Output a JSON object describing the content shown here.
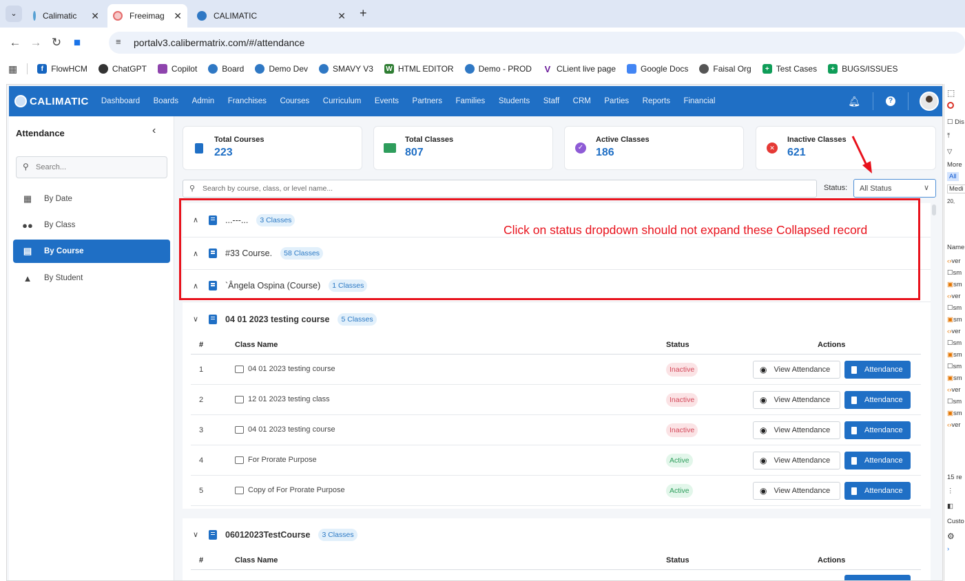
{
  "browser": {
    "tabs": [
      {
        "title": "Calimatic",
        "favicon_color": "#56a0d3"
      },
      {
        "title": "Freeimag",
        "favicon_color": "#e46a6a"
      },
      {
        "title": "CALIMATIC",
        "favicon_color": "#2f78c4"
      }
    ],
    "url": "portalv3.calibermatrix.com/#/attendance",
    "bookmarks": [
      {
        "label": "FlowHCM",
        "color": "#1565c0"
      },
      {
        "label": "ChatGPT",
        "color": "#333333"
      },
      {
        "label": "Copilot",
        "color": "#8e44ad"
      },
      {
        "label": "Board",
        "color": "#2f78c4"
      },
      {
        "label": "Demo Dev",
        "color": "#2f78c4"
      },
      {
        "label": "SMAVY V3",
        "color": "#2f78c4"
      },
      {
        "label": "HTML EDITOR",
        "color": "#2e7d32"
      },
      {
        "label": "Demo - PROD",
        "color": "#2f78c4"
      },
      {
        "label": "CLient live page",
        "color": "#6a1b9a"
      },
      {
        "label": "Google Docs",
        "color": "#4285f4"
      },
      {
        "label": "Faisal Org",
        "color": "#555555"
      },
      {
        "label": "Test Cases",
        "color": "#0f9d58"
      },
      {
        "label": "BUGS/ISSUES",
        "color": "#0f9d58"
      }
    ]
  },
  "app": {
    "logo_text": "CALIMATIC",
    "menu": [
      "Dashboard",
      "Boards",
      "Admin",
      "Franchises",
      "Courses",
      "Curriculum",
      "Events",
      "Partners",
      "Families",
      "Students",
      "Staff",
      "CRM",
      "Parties",
      "Reports",
      "Financial"
    ],
    "sidebar": {
      "title": "Attendance",
      "search_placeholder": "Search...",
      "items": [
        {
          "label": "By Date",
          "icon": "calendar-icon"
        },
        {
          "label": "By Class",
          "icon": "users-icon"
        },
        {
          "label": "By Course",
          "icon": "book-icon",
          "active": true
        },
        {
          "label": "By Student",
          "icon": "user-icon"
        }
      ]
    },
    "stats": [
      {
        "label": "Total Courses",
        "value": "223",
        "color": "#1f6fc5"
      },
      {
        "label": "Total Classes",
        "value": "807",
        "color": "#2e9d5c"
      },
      {
        "label": "Active Classes",
        "value": "186",
        "color": "#8e5bd6"
      },
      {
        "label": "Inactive Classes",
        "value": "621",
        "color": "#e53935"
      }
    ],
    "search_placeholder": "Search by course, class, or level name...",
    "status_label": "Status:",
    "status_value": "All Status",
    "courses": [
      {
        "name": "...---...",
        "badge": "3 Classes",
        "expanded": false
      },
      {
        "name": "#33 Course.",
        "badge": "58 Classes",
        "expanded": false
      },
      {
        "name": "`Ângela Ospina (Course)",
        "badge": "1 Classes",
        "expanded": false
      },
      {
        "name": "04 01 2023 testing course",
        "badge": "5 Classes",
        "expanded": true
      },
      {
        "name": "06012023TestCourse",
        "badge": "3 Classes",
        "expanded": true
      }
    ],
    "table_headers": {
      "num": "#",
      "class_name": "Class Name",
      "status": "Status",
      "actions": "Actions"
    },
    "rows": [
      {
        "num": "1",
        "name": "04 01 2023 testing course",
        "status": "Inactive"
      },
      {
        "num": "2",
        "name": "12 01 2023 testing class",
        "status": "Inactive"
      },
      {
        "num": "3",
        "name": "04 01 2023 testing course",
        "status": "Inactive"
      },
      {
        "num": "4",
        "name": "For Prorate Purpose",
        "status": "Active"
      },
      {
        "num": "5",
        "name": "Copy of For Prorate Purpose",
        "status": "Active"
      }
    ],
    "view_attendance_label": "View Attendance",
    "attendance_label": "Attendance"
  },
  "annotation": {
    "text": "Click on status dropdown should not expand these Collapsed record",
    "color": "#e8121c"
  },
  "devtools": {
    "labels": [
      "Dis",
      "More",
      "All",
      "Medi",
      "20,",
      "Name",
      "ver",
      "sm",
      "sm",
      "ver",
      "sm",
      "sm",
      "ver",
      "sm",
      "sm",
      "sm",
      "sm",
      "ver",
      "sm",
      "sm",
      "ver",
      "15 re",
      "Custo"
    ]
  }
}
